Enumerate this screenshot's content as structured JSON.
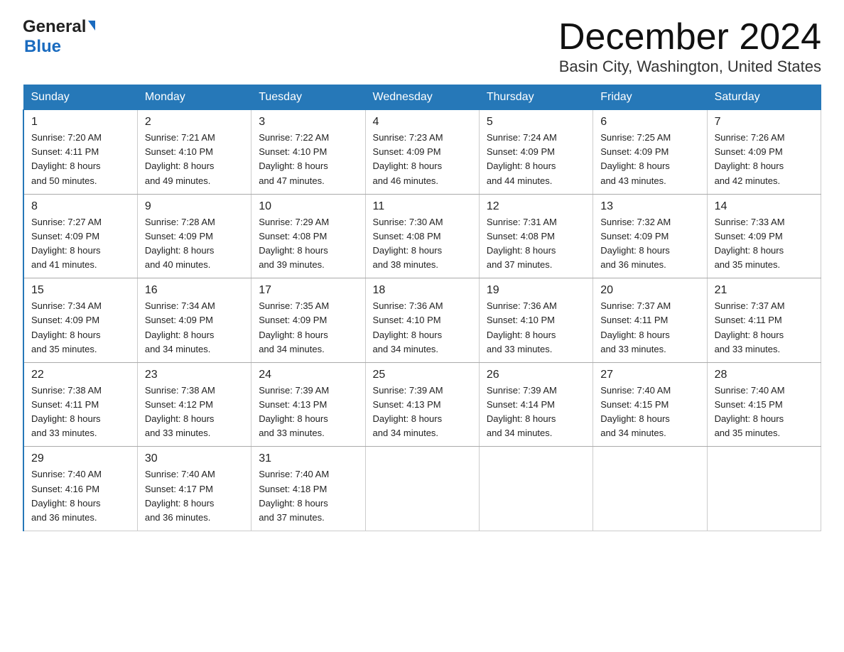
{
  "header": {
    "logo_general": "General",
    "logo_blue": "Blue",
    "month_title": "December 2024",
    "location": "Basin City, Washington, United States"
  },
  "days_of_week": [
    "Sunday",
    "Monday",
    "Tuesday",
    "Wednesday",
    "Thursday",
    "Friday",
    "Saturday"
  ],
  "weeks": [
    [
      {
        "day": "1",
        "sunrise": "7:20 AM",
        "sunset": "4:11 PM",
        "daylight": "8 hours and 50 minutes."
      },
      {
        "day": "2",
        "sunrise": "7:21 AM",
        "sunset": "4:10 PM",
        "daylight": "8 hours and 49 minutes."
      },
      {
        "day": "3",
        "sunrise": "7:22 AM",
        "sunset": "4:10 PM",
        "daylight": "8 hours and 47 minutes."
      },
      {
        "day": "4",
        "sunrise": "7:23 AM",
        "sunset": "4:09 PM",
        "daylight": "8 hours and 46 minutes."
      },
      {
        "day": "5",
        "sunrise": "7:24 AM",
        "sunset": "4:09 PM",
        "daylight": "8 hours and 44 minutes."
      },
      {
        "day": "6",
        "sunrise": "7:25 AM",
        "sunset": "4:09 PM",
        "daylight": "8 hours and 43 minutes."
      },
      {
        "day": "7",
        "sunrise": "7:26 AM",
        "sunset": "4:09 PM",
        "daylight": "8 hours and 42 minutes."
      }
    ],
    [
      {
        "day": "8",
        "sunrise": "7:27 AM",
        "sunset": "4:09 PM",
        "daylight": "8 hours and 41 minutes."
      },
      {
        "day": "9",
        "sunrise": "7:28 AM",
        "sunset": "4:09 PM",
        "daylight": "8 hours and 40 minutes."
      },
      {
        "day": "10",
        "sunrise": "7:29 AM",
        "sunset": "4:08 PM",
        "daylight": "8 hours and 39 minutes."
      },
      {
        "day": "11",
        "sunrise": "7:30 AM",
        "sunset": "4:08 PM",
        "daylight": "8 hours and 38 minutes."
      },
      {
        "day": "12",
        "sunrise": "7:31 AM",
        "sunset": "4:08 PM",
        "daylight": "8 hours and 37 minutes."
      },
      {
        "day": "13",
        "sunrise": "7:32 AM",
        "sunset": "4:09 PM",
        "daylight": "8 hours and 36 minutes."
      },
      {
        "day": "14",
        "sunrise": "7:33 AM",
        "sunset": "4:09 PM",
        "daylight": "8 hours and 35 minutes."
      }
    ],
    [
      {
        "day": "15",
        "sunrise": "7:34 AM",
        "sunset": "4:09 PM",
        "daylight": "8 hours and 35 minutes."
      },
      {
        "day": "16",
        "sunrise": "7:34 AM",
        "sunset": "4:09 PM",
        "daylight": "8 hours and 34 minutes."
      },
      {
        "day": "17",
        "sunrise": "7:35 AM",
        "sunset": "4:09 PM",
        "daylight": "8 hours and 34 minutes."
      },
      {
        "day": "18",
        "sunrise": "7:36 AM",
        "sunset": "4:10 PM",
        "daylight": "8 hours and 34 minutes."
      },
      {
        "day": "19",
        "sunrise": "7:36 AM",
        "sunset": "4:10 PM",
        "daylight": "8 hours and 33 minutes."
      },
      {
        "day": "20",
        "sunrise": "7:37 AM",
        "sunset": "4:11 PM",
        "daylight": "8 hours and 33 minutes."
      },
      {
        "day": "21",
        "sunrise": "7:37 AM",
        "sunset": "4:11 PM",
        "daylight": "8 hours and 33 minutes."
      }
    ],
    [
      {
        "day": "22",
        "sunrise": "7:38 AM",
        "sunset": "4:11 PM",
        "daylight": "8 hours and 33 minutes."
      },
      {
        "day": "23",
        "sunrise": "7:38 AM",
        "sunset": "4:12 PM",
        "daylight": "8 hours and 33 minutes."
      },
      {
        "day": "24",
        "sunrise": "7:39 AM",
        "sunset": "4:13 PM",
        "daylight": "8 hours and 33 minutes."
      },
      {
        "day": "25",
        "sunrise": "7:39 AM",
        "sunset": "4:13 PM",
        "daylight": "8 hours and 34 minutes."
      },
      {
        "day": "26",
        "sunrise": "7:39 AM",
        "sunset": "4:14 PM",
        "daylight": "8 hours and 34 minutes."
      },
      {
        "day": "27",
        "sunrise": "7:40 AM",
        "sunset": "4:15 PM",
        "daylight": "8 hours and 34 minutes."
      },
      {
        "day": "28",
        "sunrise": "7:40 AM",
        "sunset": "4:15 PM",
        "daylight": "8 hours and 35 minutes."
      }
    ],
    [
      {
        "day": "29",
        "sunrise": "7:40 AM",
        "sunset": "4:16 PM",
        "daylight": "8 hours and 36 minutes."
      },
      {
        "day": "30",
        "sunrise": "7:40 AM",
        "sunset": "4:17 PM",
        "daylight": "8 hours and 36 minutes."
      },
      {
        "day": "31",
        "sunrise": "7:40 AM",
        "sunset": "4:18 PM",
        "daylight": "8 hours and 37 minutes."
      },
      null,
      null,
      null,
      null
    ]
  ],
  "labels": {
    "sunrise": "Sunrise:",
    "sunset": "Sunset:",
    "daylight": "Daylight:"
  }
}
